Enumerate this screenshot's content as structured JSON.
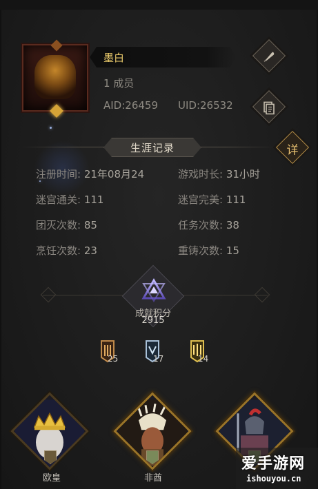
{
  "profile": {
    "name": "墨白",
    "members": "1 成员",
    "aid": "AID:26459",
    "uid": "UID:26532"
  },
  "career": {
    "title": "生涯记录",
    "detail_label": "详",
    "stats": [
      {
        "label": "注册时间:",
        "value": "21年08月24"
      },
      {
        "label": "游戏时长:",
        "value": "31小时"
      },
      {
        "label": "迷宫通关:",
        "value": "111"
      },
      {
        "label": "迷宫完美:",
        "value": "111"
      },
      {
        "label": "团灭次数:",
        "value": "85"
      },
      {
        "label": "任务次数:",
        "value": "38"
      },
      {
        "label": "烹饪次数:",
        "value": "23"
      },
      {
        "label": "重铸次数:",
        "value": "15"
      }
    ]
  },
  "achievement": {
    "label": "成就积分",
    "score": "2915",
    "badges": [
      {
        "name": "bronze",
        "count": "25",
        "color": "#c08a4a"
      },
      {
        "name": "silver",
        "count": "17",
        "color": "#a8c0d8"
      },
      {
        "name": "gold",
        "count": "14",
        "color": "#e0c050"
      }
    ]
  },
  "characters": [
    {
      "name": "欧皇",
      "icon": "crowned-king-portrait"
    },
    {
      "name": "非酋",
      "icon": "feathered-warrior-portrait"
    },
    {
      "name": "",
      "icon": "armored-knight-portrait"
    }
  ],
  "watermark": {
    "main": "爱手游网",
    "sub": "ishouyou.cn"
  }
}
